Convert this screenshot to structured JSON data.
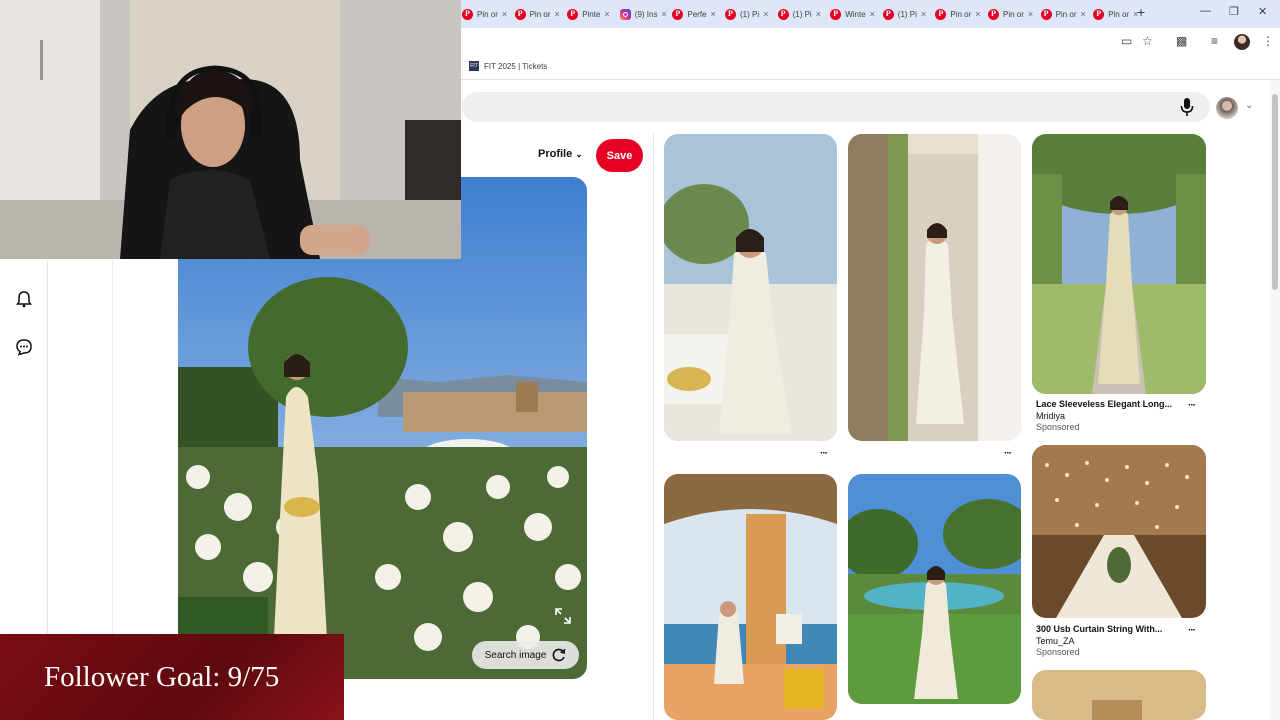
{
  "browser": {
    "tabs": [
      {
        "label": "Pin or",
        "icon": "pinterest-icon"
      },
      {
        "label": "Pin or",
        "icon": "pinterest-icon"
      },
      {
        "label": "Pinte",
        "icon": "pinterest-icon"
      },
      {
        "label": "(9) Ins",
        "icon": "instagram-icon"
      },
      {
        "label": "Perfe",
        "icon": "pinterest-icon"
      },
      {
        "label": "(1) Pi",
        "icon": "pinterest-icon"
      },
      {
        "label": "(1) Pi",
        "icon": "pinterest-icon"
      },
      {
        "label": "Winte",
        "icon": "pinterest-icon"
      },
      {
        "label": "(1) Pi",
        "icon": "pinterest-icon"
      },
      {
        "label": "Pin or",
        "icon": "pinterest-icon"
      },
      {
        "label": "Pin or",
        "icon": "pinterest-icon"
      },
      {
        "label": "Pin or",
        "icon": "pinterest-icon"
      },
      {
        "label": "Pin or",
        "icon": "pinterest-icon"
      }
    ],
    "new_tab": "+",
    "bookmark": {
      "label": "FIT 2025 | Tickets",
      "icon_text": "FIT"
    }
  },
  "closeup": {
    "profile_label": "Profile",
    "save_label": "Save",
    "search_image_label": "Search image"
  },
  "pins": [
    {
      "title": "Lace Sleeveless Elegant Long...",
      "source": "Mridiya",
      "sponsored": "Sponsored"
    },
    {
      "title": "300 Usb Curtain String With...",
      "source": "Temu_ZA",
      "sponsored": "Sponsored"
    }
  ],
  "overlay": {
    "goal_text": "Follower Goal: 9/75"
  },
  "colors": {
    "pinterest_red": "#e60023",
    "goal_bg": "#6e0b11"
  }
}
